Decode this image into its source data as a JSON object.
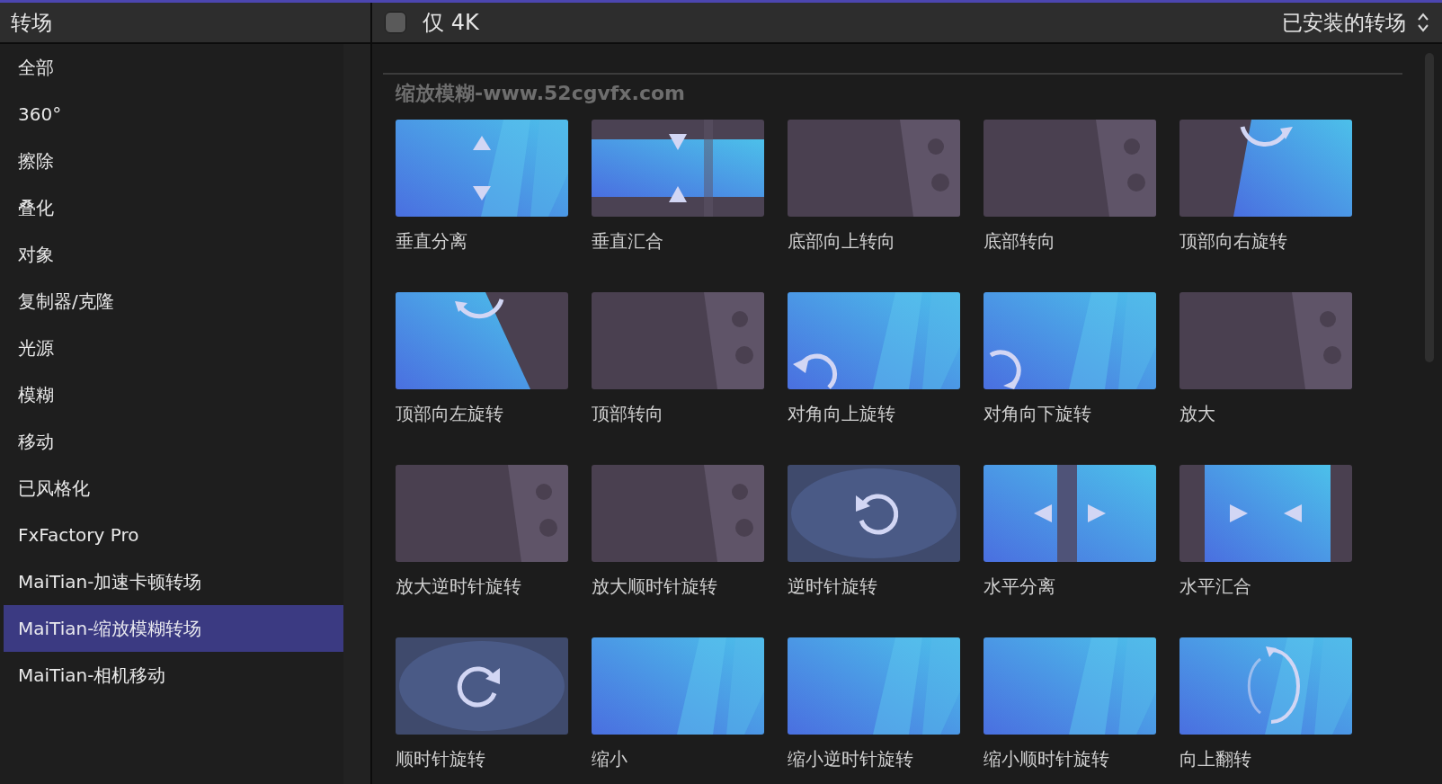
{
  "header": {
    "title": "转场"
  },
  "filter": {
    "label": "仅 4K",
    "checked": false
  },
  "sort_menu": {
    "label": "已安装的转场"
  },
  "categories": [
    {
      "label": "全部",
      "selected": false
    },
    {
      "label": "360°",
      "selected": false
    },
    {
      "label": "擦除",
      "selected": false
    },
    {
      "label": "叠化",
      "selected": false
    },
    {
      "label": "对象",
      "selected": false
    },
    {
      "label": "复制器/克隆",
      "selected": false
    },
    {
      "label": "光源",
      "selected": false
    },
    {
      "label": "模糊",
      "selected": false
    },
    {
      "label": "移动",
      "selected": false
    },
    {
      "label": "已风格化",
      "selected": false
    },
    {
      "label": "FxFactory Pro",
      "selected": false
    },
    {
      "label": "MaiTian-加速卡顿转场",
      "selected": false
    },
    {
      "label": "MaiTian-缩放模糊转场",
      "selected": true
    },
    {
      "label": "MaiTian-相机移动",
      "selected": false
    }
  ],
  "section": {
    "title": "缩放模糊-www.52cgvfx.com",
    "items": [
      {
        "label": "垂直分离"
      },
      {
        "label": "垂直汇合"
      },
      {
        "label": "底部向上转向"
      },
      {
        "label": "底部转向"
      },
      {
        "label": "顶部向右旋转"
      },
      {
        "label": "顶部向左旋转"
      },
      {
        "label": "顶部转向"
      },
      {
        "label": "对角向上旋转"
      },
      {
        "label": "对角向下旋转"
      },
      {
        "label": "放大"
      },
      {
        "label": "放大逆时针旋转"
      },
      {
        "label": "放大顺时针旋转"
      },
      {
        "label": "逆时针旋转"
      },
      {
        "label": "水平分离"
      },
      {
        "label": "水平汇合"
      },
      {
        "label": "顺时针旋转"
      },
      {
        "label": "缩小"
      },
      {
        "label": "缩小逆时针旋转"
      },
      {
        "label": "缩小顺时针旋转"
      },
      {
        "label": "向上翻转"
      }
    ]
  }
}
